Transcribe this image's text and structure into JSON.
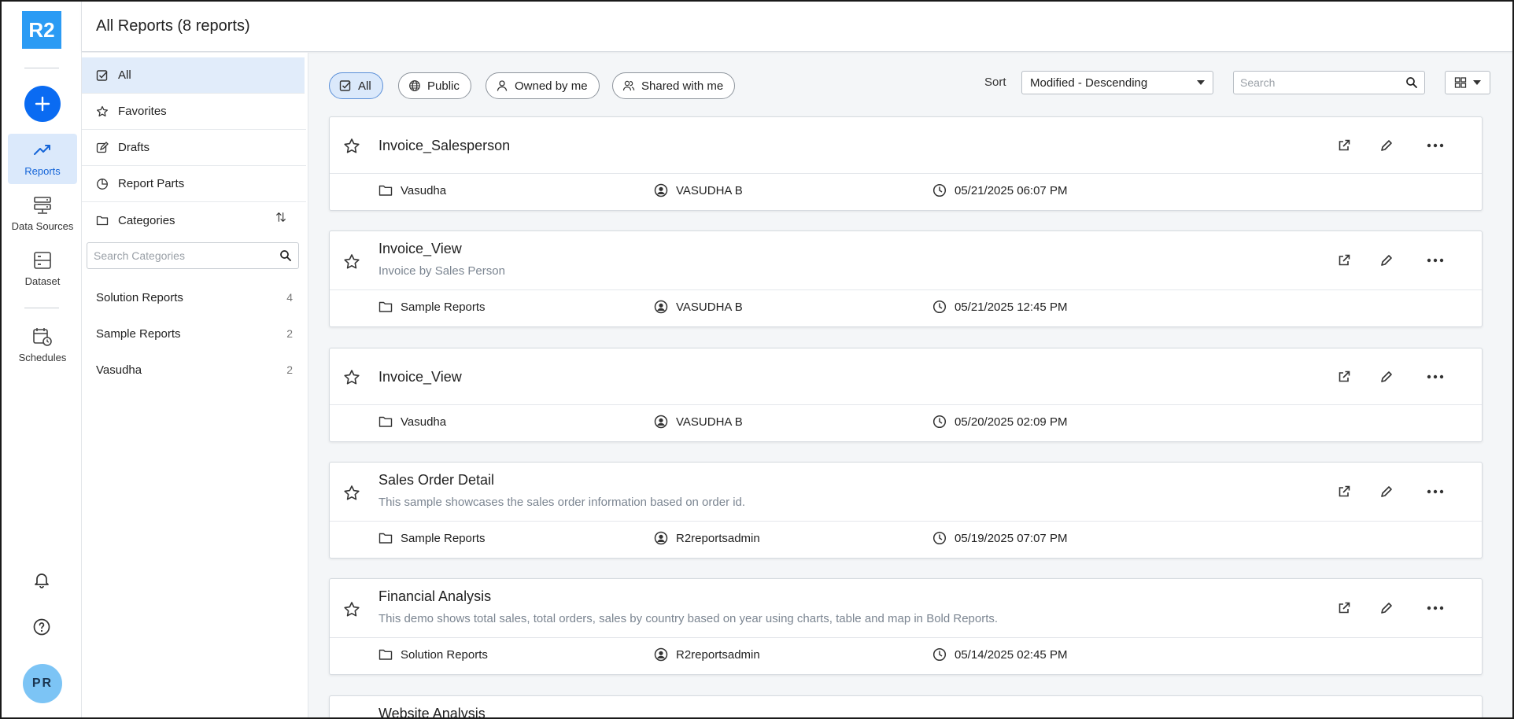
{
  "app": {
    "logo_text": "R2"
  },
  "rail": {
    "items": [
      {
        "label": "Reports",
        "icon": "trending-up-icon",
        "active": true
      },
      {
        "label": "Data Sources",
        "icon": "server-icon"
      },
      {
        "label": "Dataset",
        "icon": "dataset-icon"
      },
      {
        "label": "Schedules",
        "icon": "calendar-clock-icon"
      }
    ],
    "avatar_initials": "PR",
    "accent": "#0a6bf2"
  },
  "header": {
    "title": "All Reports (8 reports)"
  },
  "categories_panel": {
    "nav": [
      {
        "label": "All",
        "icon": "checkbox-icon",
        "active": true
      },
      {
        "label": "Favorites",
        "icon": "star-icon"
      },
      {
        "label": "Drafts",
        "icon": "edit-icon"
      },
      {
        "label": "Report Parts",
        "icon": "pie-icon"
      },
      {
        "label": "Categories",
        "icon": "folder-icon"
      }
    ],
    "search_placeholder": "Search Categories",
    "categories": [
      {
        "name": "Solution Reports",
        "count": "4"
      },
      {
        "name": "Sample Reports",
        "count": "2"
      },
      {
        "name": "Vasudha",
        "count": "2"
      }
    ]
  },
  "toolbar": {
    "filters": [
      {
        "label": "All",
        "icon": "checkbox-icon",
        "active": true
      },
      {
        "label": "Public",
        "icon": "globe-icon"
      },
      {
        "label": "Owned by me",
        "icon": "user-icon"
      },
      {
        "label": "Shared with me",
        "icon": "users-icon"
      }
    ],
    "sort_label": "Sort",
    "sort_value": "Modified - Descending",
    "search_placeholder": "Search"
  },
  "reports": [
    {
      "title": "Invoice_Salesperson",
      "description": "",
      "category": "Vasudha",
      "owner": "VASUDHA B",
      "modified": "05/21/2025 06:07 PM"
    },
    {
      "title": "Invoice_View",
      "description": "Invoice by Sales Person",
      "category": "Sample Reports",
      "owner": "VASUDHA B",
      "modified": "05/21/2025 12:45 PM"
    },
    {
      "title": "Invoice_View",
      "description": "",
      "category": "Vasudha",
      "owner": "VASUDHA B",
      "modified": "05/20/2025 02:09 PM"
    },
    {
      "title": "Sales Order Detail",
      "description": "This sample showcases the sales order information based on order id.",
      "category": "Sample Reports",
      "owner": "R2reportsadmin",
      "modified": "05/19/2025 07:07 PM"
    },
    {
      "title": "Financial Analysis",
      "description": "This demo shows total sales, total orders, sales by country based on year using charts, table and map in Bold Reports.",
      "category": "Solution Reports",
      "owner": "R2reportsadmin",
      "modified": "05/14/2025 02:45 PM"
    },
    {
      "title": "Website Analysis",
      "description": "",
      "category": "",
      "owner": "",
      "modified": ""
    }
  ]
}
